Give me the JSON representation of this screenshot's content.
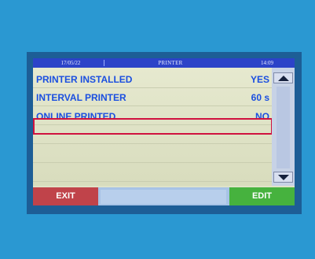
{
  "header": {
    "date": "17/05/22",
    "title": "PRINTER",
    "time": "14:09"
  },
  "rows": [
    {
      "label": "PRINTER INSTALLED",
      "value": "YES"
    },
    {
      "label": "INTERVAL PRINTER",
      "value": "60 s"
    },
    {
      "label": "ONLINE PRINTED",
      "value": "NO"
    }
  ],
  "footer": {
    "exit_label": "EXIT",
    "edit_label": "EDIT"
  },
  "colors": {
    "header_bg": "#2c43c8",
    "text_blue": "#1b4fe0",
    "highlight_red": "#d0123f",
    "exit_red": "#c0434a",
    "edit_green": "#46b23e"
  },
  "icons": {
    "scroll_up": "triangle-up-icon",
    "scroll_down": "triangle-down-icon"
  }
}
